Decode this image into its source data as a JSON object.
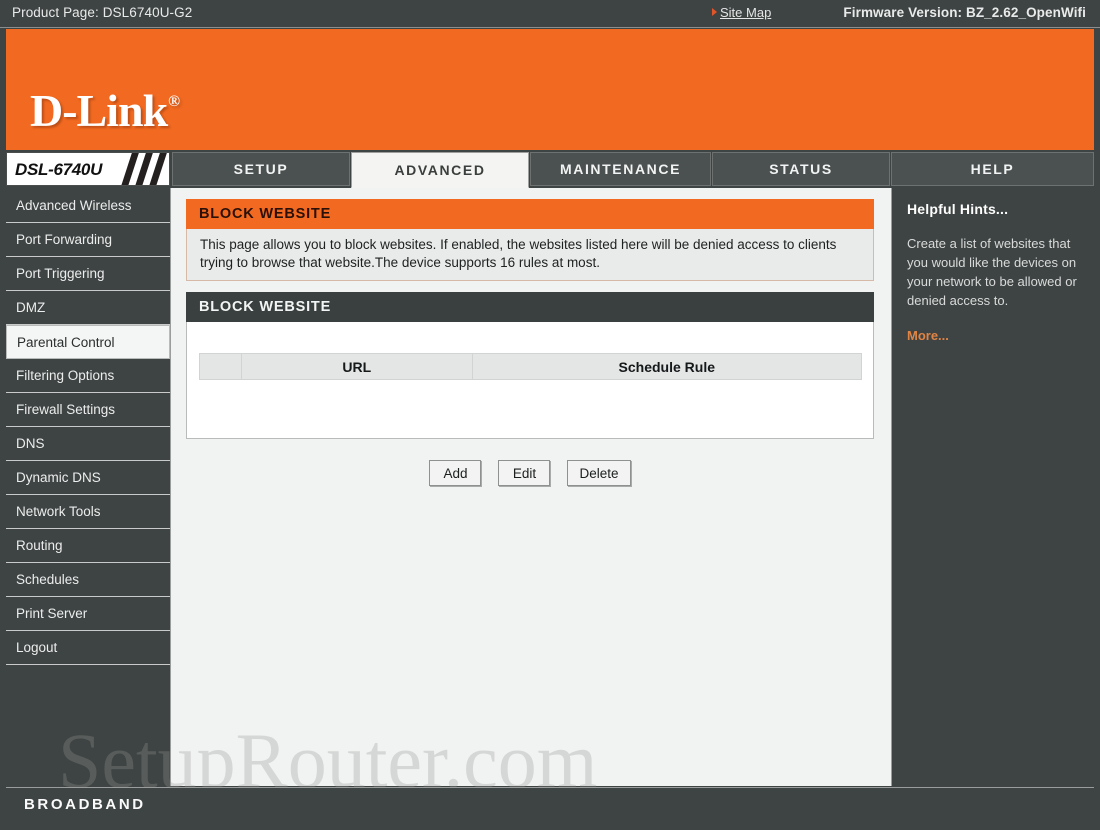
{
  "topbar": {
    "product_page": "Product Page: DSL6740U-G2",
    "site_map": "Site Map",
    "firmware": "Firmware Version: BZ_2.62_OpenWifi"
  },
  "brand": {
    "logo_text": "D-Link",
    "registered_mark": "®",
    "model_badge": "DSL-6740U",
    "accent_orange": "#F26A21",
    "panel_dark": "#3E4443"
  },
  "tabs": [
    {
      "label": "SETUP",
      "active": false
    },
    {
      "label": "ADVANCED",
      "active": true
    },
    {
      "label": "MAINTENANCE",
      "active": false
    },
    {
      "label": "STATUS",
      "active": false
    },
    {
      "label": "HELP",
      "active": false
    }
  ],
  "sidebar": {
    "items": [
      {
        "label": "Advanced Wireless",
        "active": false
      },
      {
        "label": "Port Forwarding",
        "active": false
      },
      {
        "label": "Port Triggering",
        "active": false
      },
      {
        "label": "DMZ",
        "active": false
      },
      {
        "label": "Parental Control",
        "active": true
      },
      {
        "label": "Filtering Options",
        "active": false
      },
      {
        "label": "Firewall Settings",
        "active": false
      },
      {
        "label": "DNS",
        "active": false
      },
      {
        "label": "Dynamic DNS",
        "active": false
      },
      {
        "label": "Network Tools",
        "active": false
      },
      {
        "label": "Routing",
        "active": false
      },
      {
        "label": "Schedules",
        "active": false
      },
      {
        "label": "Print Server",
        "active": false
      },
      {
        "label": "Logout",
        "active": false
      }
    ]
  },
  "main": {
    "section_title": "BLOCK WEBSITE",
    "description": "This page allows you to block websites. If enabled, the websites listed here will be denied access to clients trying to browse that website.The device supports 16 rules at most.",
    "table_title": "BLOCK WEBSITE",
    "table": {
      "columns": [
        "",
        "URL",
        "Schedule Rule"
      ],
      "rows": []
    },
    "buttons": [
      {
        "label": "Add"
      },
      {
        "label": "Edit"
      },
      {
        "label": "Delete"
      }
    ]
  },
  "hints": {
    "title": "Helpful Hints...",
    "body": "Create a list of websites that you would like the devices on your network to be allowed or denied access to.",
    "more": "More..."
  },
  "footer": {
    "label": "BROADBAND"
  },
  "watermark": {
    "text": "SetupRouter.com"
  }
}
